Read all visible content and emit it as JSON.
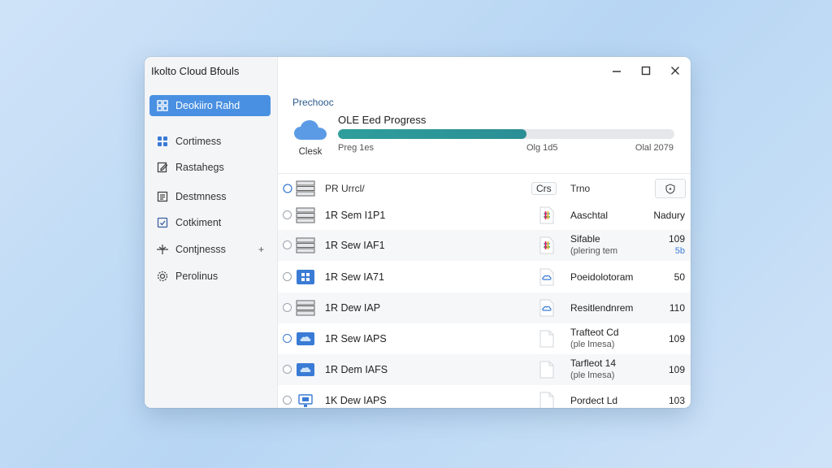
{
  "app": {
    "title": "Ikolto Cloud Bfouls"
  },
  "sidebar": {
    "items": [
      {
        "label": "Deokiiro Rahd",
        "icon": "grid-icon",
        "active": true
      },
      {
        "label": "Cortimess",
        "icon": "apps-icon"
      },
      {
        "label": "Rastahegs",
        "icon": "edit-icon"
      },
      {
        "label": "Destmness",
        "icon": "document-list-icon"
      },
      {
        "label": "Cotkiment",
        "icon": "check-document-icon"
      },
      {
        "label": "Contjnesss",
        "icon": "network-icon",
        "caret": "+"
      },
      {
        "label": "Perolinus",
        "icon": "gear-icon"
      }
    ]
  },
  "progress": {
    "heading": "Prechooc",
    "cloud_label": "Clesk",
    "title": "OLE Eed Progress",
    "fraction": 0.56,
    "left_meta": "Preg 1es",
    "mid_meta": "Olg 1d5",
    "right_meta": "Olal 2079"
  },
  "table": {
    "headers": {
      "name": "PR Urrcl/",
      "cars": "Crs",
      "time": "Trno"
    },
    "rows": [
      {
        "name": "1R Sem I1P1",
        "icon": "server-icon",
        "file_icon": "slack-file-icon",
        "title": "Aaschtal",
        "sub": "",
        "value": "Nadury",
        "value_sub": ""
      },
      {
        "name": "1R Sew IAF1",
        "icon": "server-icon",
        "file_icon": "slack-file-icon",
        "title": "Sifable",
        "sub": "(plering tem",
        "value": "109",
        "value_sub": "5b"
      },
      {
        "name": "1R Sew IA71",
        "icon": "windows-icon",
        "file_icon": "cloud-file-icon",
        "title": "Poeidolotoram",
        "sub": "",
        "value": "50",
        "value_sub": ""
      },
      {
        "name": "1R Dew IAP",
        "icon": "server-icon",
        "file_icon": "cloud-file-icon",
        "title": "Resitlendnrem",
        "sub": "",
        "value": "110",
        "value_sub": ""
      },
      {
        "name": "1R Sew IAPS",
        "icon": "cloud-tile-icon",
        "file_icon": "blank-file-icon",
        "title": "Trafteot Cd",
        "sub": "(ple lmesa)",
        "value": "109",
        "value_sub": ""
      },
      {
        "name": "1R Dem IAFS",
        "icon": "cloud-tile-icon",
        "file_icon": "blank-file-icon",
        "title": "Tarfleot 14",
        "sub": "(ple lmesa)",
        "value": "109",
        "value_sub": ""
      },
      {
        "name": "1K Dew IAPS",
        "icon": "monitor-icon",
        "file_icon": "blank-file-icon",
        "title": "Pordect Ld",
        "sub": "",
        "value": "103",
        "value_sub": ""
      }
    ]
  }
}
